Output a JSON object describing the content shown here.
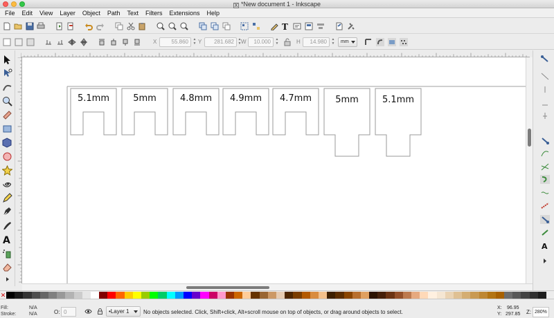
{
  "window": {
    "title": "*New document 1 - Inkscape"
  },
  "menu": [
    "File",
    "Edit",
    "View",
    "Layer",
    "Object",
    "Path",
    "Text",
    "Filters",
    "Extensions",
    "Help"
  ],
  "controls": {
    "x_label": "X",
    "x_value": "55.860",
    "y_label": "Y",
    "y_value": "281.682",
    "w_label": "W",
    "w_value": "10.000",
    "h_label": "H",
    "h_value": "14.980",
    "unit": "mm"
  },
  "shapes": [
    {
      "label": "5.1mm",
      "style": "notch"
    },
    {
      "label": "5mm",
      "style": "notch"
    },
    {
      "label": "4.8mm",
      "style": "notch"
    },
    {
      "label": "4.9mm",
      "style": "notch"
    },
    {
      "label": "4.7mm",
      "style": "notch"
    },
    {
      "label": "5mm",
      "style": "tab"
    },
    {
      "label": "5.1mm",
      "style": "tab"
    }
  ],
  "status": {
    "fill_label": "Fill:",
    "fill_value": "N/A",
    "stroke_label": "Stroke:",
    "stroke_value": "N/A",
    "opacity_label": "O:",
    "opacity_value": "0",
    "layer": "•Layer 1",
    "message": "No objects selected. Click, Shift+click, Alt+scroll mouse on top of objects, or drag around objects to select.",
    "x_label": "X:",
    "x_value": "96.95",
    "y_label": "Y:",
    "y_value": "297.85",
    "zoom_label": "Z:",
    "zoom_value": "280%"
  },
  "palette": [
    "#000000",
    "#1a1a1a",
    "#333333",
    "#4d4d4d",
    "#666666",
    "#808080",
    "#999999",
    "#b3b3b3",
    "#cccccc",
    "#e6e6e6",
    "#ffffff",
    "#800000",
    "#ff0000",
    "#ff6600",
    "#ffcc00",
    "#ffff00",
    "#99cc00",
    "#00ff00",
    "#00cc66",
    "#00ffff",
    "#0099ff",
    "#0000ff",
    "#6600cc",
    "#ff00ff",
    "#cc0066",
    "#ff99cc",
    "#993300",
    "#cc6600",
    "#ffcc99",
    "#663300",
    "#996633",
    "#cc9966",
    "#e6ccb3",
    "#4d2600",
    "#7a3d00",
    "#b35900",
    "#d98c3f",
    "#f2c08c",
    "#3d1f00",
    "#5c2e00",
    "#8a4500",
    "#b86f2e",
    "#e0a060",
    "#2b1200",
    "#45200a",
    "#6b3414",
    "#94502a",
    "#bd7a4f",
    "#e6a97f",
    "#ffd9b8",
    "#fff0e0",
    "#f5e6d3",
    "#ead3b3",
    "#dfc093",
    "#d4ad73",
    "#c99a53",
    "#be8733",
    "#b37413",
    "#a86100",
    "#6d6d6d",
    "#585858",
    "#444444",
    "#303030",
    "#1c1c1c"
  ],
  "colors": {
    "canvas": "#ffffff",
    "shape_stroke": "#9a9a9a",
    "page_border": "#9f9f9f",
    "chrome": "#ececec"
  }
}
